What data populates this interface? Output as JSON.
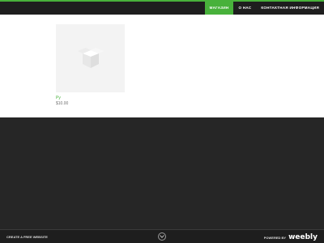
{
  "nav": {
    "items": [
      {
        "label": "МАГАЗИН",
        "active": true
      },
      {
        "label": "О НАС",
        "active": false
      },
      {
        "label": "КОНТАКТНАЯ ИНФОРМАЦИЯ",
        "active": false
      }
    ]
  },
  "product": {
    "name": "Ру",
    "price": "$10.00",
    "image_icon": "placeholder-box-icon"
  },
  "footer": {
    "create_label": "CREATE A FREE WEBSITE",
    "toggle_icon": "chevron-down-icon",
    "powered_label": "POWERED BY",
    "brand": "weebly"
  },
  "colors": {
    "accent": "#48b13b",
    "header_bg": "#1e1e1e",
    "content_bg": "#ffffff",
    "body_bg": "#262626",
    "price_text": "#707070"
  }
}
